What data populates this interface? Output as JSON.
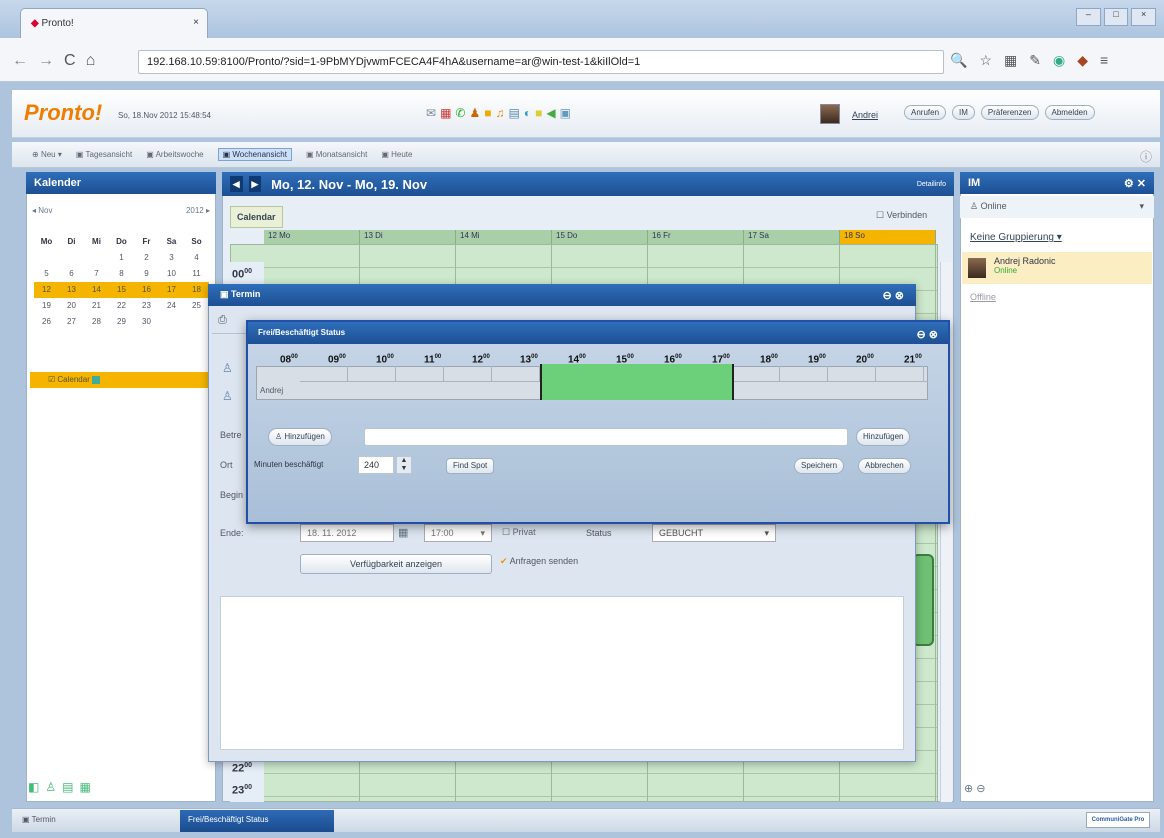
{
  "browser": {
    "tab_title": "Pronto!",
    "url": "192.168.10.59:8100/Pronto/?sid=1-9PbMYDjvwmFCECA4F4hA&username=ar@win-test-1&kiIlOld=1"
  },
  "app": {
    "logo": "Pronto!",
    "datetime": "So, 18.Nov 2012 15:48:54",
    "user": "Andrei",
    "buttons": [
      "Anrufen",
      "IM",
      "Präferenzen",
      "Abmelden"
    ]
  },
  "toolbar": {
    "new": "Neu",
    "views": [
      "Tagesansicht",
      "Arbeitswoche",
      "Wochenansicht",
      "Monatsansicht",
      "Heute"
    ]
  },
  "left": {
    "title": "Kalender",
    "month": "Nov",
    "year": "2012",
    "weekdays": [
      "Mo",
      "Di",
      "Mi",
      "Do",
      "Fr",
      "Sa",
      "So"
    ],
    "weeks": [
      [
        "",
        "",
        "",
        "1",
        "2",
        "3",
        "4"
      ],
      [
        "5",
        "6",
        "7",
        "8",
        "9",
        "10",
        "11"
      ],
      [
        "12",
        "13",
        "14",
        "15",
        "16",
        "17",
        "18"
      ],
      [
        "19",
        "20",
        "21",
        "22",
        "23",
        "24",
        "25"
      ],
      [
        "26",
        "27",
        "28",
        "29",
        "30",
        "",
        ""
      ]
    ],
    "calendar_item": "Calendar"
  },
  "center": {
    "range": "Mo, 12. Nov - Mo, 19. Nov",
    "top_info": "Detailinfo",
    "tab": "Calendar",
    "connect": "Verbinden",
    "days": [
      {
        "num": "12",
        "name": "Mo"
      },
      {
        "num": "13",
        "name": "Di"
      },
      {
        "num": "14",
        "name": "Mi"
      },
      {
        "num": "15",
        "name": "Do"
      },
      {
        "num": "16",
        "name": "Fr"
      },
      {
        "num": "17",
        "name": "Sa"
      },
      {
        "num": "18",
        "name": "So"
      }
    ],
    "hours": {
      "first": "00",
      "last1": "22",
      "last2": "23",
      "sup": "00"
    }
  },
  "im": {
    "title": "IM",
    "status": "Online",
    "grouping": "Keine Gruppierung",
    "contact_name": "Andrej Radonic",
    "contact_status": "Online",
    "offline": "Offline"
  },
  "termin": {
    "title": "Termin",
    "ende_label": "Ende:",
    "ende_date": "18. 11. 2012",
    "ende_time": "17:00",
    "privat": "Privat",
    "status_label": "Status",
    "status_value": "GEBUCHT",
    "avail_button": "Verfügbarkeit anzeigen",
    "send_requests": "Anfragen senden",
    "side_labels": [
      "Betre",
      "Ort",
      "Begin"
    ]
  },
  "fb": {
    "title": "Frei/Beschäftigt Status",
    "hours": [
      "08",
      "09",
      "10",
      "11",
      "12",
      "13",
      "14",
      "15",
      "16",
      "17",
      "18",
      "19",
      "20",
      "21"
    ],
    "sup": "00",
    "row_label": "Andrej",
    "add_left": "Hinzufügen",
    "add_right": "Hinzufügen",
    "minutes_label": "Minuten beschäftigt",
    "minutes_value": "240",
    "find_spot": "Find Spot",
    "save": "Speichern",
    "cancel": "Abbrechen"
  },
  "taskbar": {
    "items": [
      "Termin",
      "Frei/Beschäftigt Status"
    ],
    "brand": "CommuniGate Pro"
  },
  "colors": {
    "header_blue": "#1d4f93",
    "today": "#f4b400",
    "busy_green": "#6ccf79"
  }
}
